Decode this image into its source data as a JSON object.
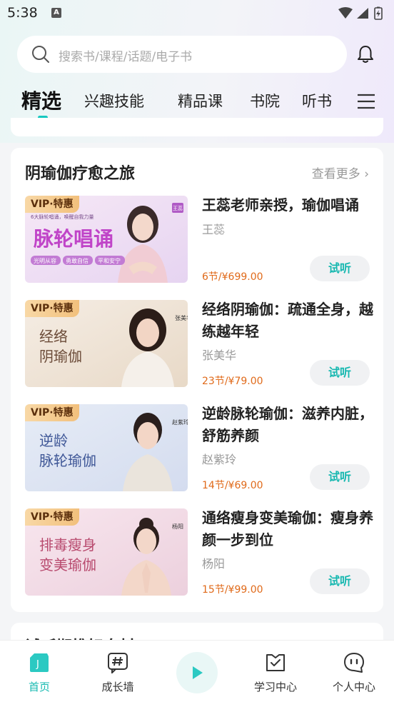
{
  "status_bar": {
    "time": "5:38",
    "notification_icon": "A"
  },
  "search": {
    "placeholder": "搜索书/课程/话题/电子书"
  },
  "tabs": [
    {
      "label": "精选",
      "active": true
    },
    {
      "label": "兴趣技能"
    },
    {
      "label": "精品课"
    },
    {
      "label": "书院"
    },
    {
      "label": "听书"
    }
  ],
  "section": {
    "title": "阴瑜伽疗愈之旅",
    "see_more": "查看更多 ›",
    "try_label": "试听",
    "courses": [
      {
        "badge": "VIP·特惠",
        "title": "王蕊老师亲授，瑜伽唱诵",
        "author": "王蕊",
        "price": "6节/¥699.00",
        "thumb": {
          "main_text": "脉轮唱诵",
          "sub_text": "6大脉轮唱诵，唤醒自我力量",
          "tags": [
            "光明从容",
            "勇敢自信",
            "平和安宁"
          ],
          "name": "王蕊",
          "bg_start": "#f6e8f6",
          "bg_end": "#e9d9f3",
          "accent": "#c044c8"
        }
      },
      {
        "badge": "VIP·特惠",
        "title": "经络阴瑜伽：疏通全身，越练越年轻",
        "author": "张美华",
        "price": "23节/¥79.00",
        "thumb": {
          "main_text": "经络",
          "main_text2": "阴瑜伽",
          "name": "张美华",
          "bg_start": "#f5ede4",
          "bg_end": "#eadccb",
          "accent": "#6b4b38"
        }
      },
      {
        "badge": "VIP·特惠",
        "title": "逆龄脉轮瑜伽：滋养内脏，舒筋养颜",
        "author": "赵紫玲",
        "price": "14节/¥69.00",
        "thumb": {
          "main_text": "逆龄",
          "main_text2": "脉轮瑜伽",
          "name": "赵紫玲",
          "bg_start": "#e6ecf6",
          "bg_end": "#d6def0",
          "accent": "#3f5797"
        }
      },
      {
        "badge": "VIP·特惠",
        "title": "通络瘦身变美瑜伽：瘦身养颜一步到位",
        "author": "杨阳",
        "price": "15节/¥99.00",
        "thumb": {
          "main_text": "排毒瘦身",
          "main_text2": "变美瑜伽",
          "name": "杨阳",
          "bg_start": "#f8e6ee",
          "bg_end": "#edd2df",
          "accent": "#b84a6e"
        }
      }
    ]
  },
  "next_section": {
    "title": "试听期推好身材"
  },
  "bottom_nav": [
    {
      "label": "首页",
      "icon": "home-icon",
      "active": true
    },
    {
      "label": "成长墙",
      "icon": "hashtag-icon"
    },
    {
      "label": "",
      "icon": "play-icon"
    },
    {
      "label": "学习中心",
      "icon": "study-icon"
    },
    {
      "label": "个人中心",
      "icon": "chat-face-icon"
    }
  ],
  "colors": {
    "accent": "#17c8c0",
    "price": "#e06a1a",
    "vip_badge": "#f2c07c"
  }
}
